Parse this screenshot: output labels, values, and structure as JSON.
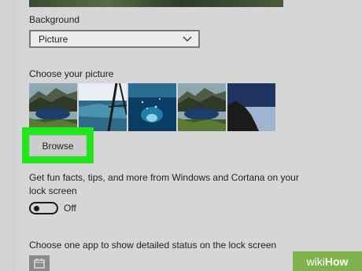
{
  "background": {
    "label": "Background",
    "dropdown_value": "Picture"
  },
  "choose_picture": {
    "label": "Choose your picture",
    "thumbnails": [
      "mountain-lake",
      "boat-water",
      "underwater-blue",
      "mountain-lake-2",
      "cliff-sky"
    ]
  },
  "browse": {
    "label": "Browse",
    "highlight_color": "#22e51d"
  },
  "fun_facts": {
    "text": "Get fun facts, tips, and more from Windows and Cortana on your lock screen",
    "toggle_state": "Off"
  },
  "status": {
    "label": "Choose one app to show detailed status on the lock screen",
    "app_icon": "calendar-icon"
  },
  "watermark": {
    "text_wiki": "wiki",
    "text_how": "How"
  }
}
